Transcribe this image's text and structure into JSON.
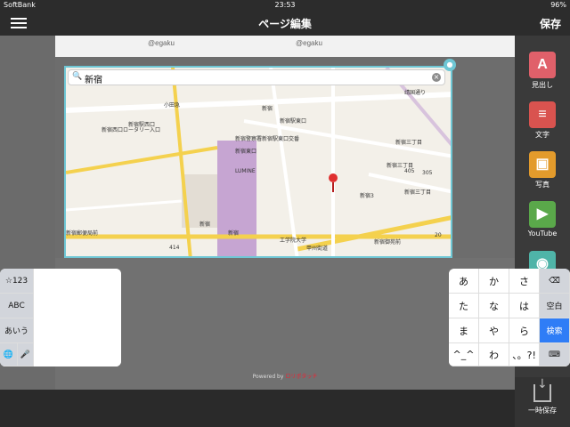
{
  "status": {
    "carrier": "SoftBank",
    "time": "23:53",
    "battery": "96%"
  },
  "nav": {
    "title": "ページ編集",
    "save": "保存"
  },
  "page": {
    "footer_prefix": "Powered by",
    "footer_brand": "ロリポタッチ",
    "art_texts": [
      "@egaku",
      "@egaku"
    ]
  },
  "map": {
    "search_value": "新宿",
    "labels": [
      "新宿西口ロータリー入口",
      "新宿駅西口",
      "新宿駅東口",
      "新宿警察署新宿駅東口交番",
      "新宿三丁目",
      "新宿三丁目",
      "新宿三丁目",
      "新宿3",
      "新宿御苑前",
      "新宿郵便局前",
      "新宿",
      "小田急",
      "甲州街道",
      "新宿",
      "新宿東口",
      "LUMINE",
      "405",
      "20",
      "414",
      "305",
      "靖国通り",
      "新宿",
      "工学院大学"
    ]
  },
  "sidebar": {
    "tools": [
      {
        "label": "見出し",
        "icon": "A",
        "color": "#e0606a"
      },
      {
        "label": "文字",
        "icon": "≡",
        "color": "#d9534f"
      },
      {
        "label": "写真",
        "icon": "▣",
        "color": "#e39b2c"
      },
      {
        "label": "YouTube",
        "icon": "▶",
        "color": "#5aa84a"
      },
      {
        "label": "",
        "icon": "◉",
        "color": "#4fb4a8"
      }
    ],
    "temp_save": "一時保存"
  },
  "keyboard": {
    "left_keys": [
      "☆123",
      "ABC",
      "あいう"
    ],
    "right_keys": [
      [
        "あ",
        "か",
        "さ"
      ],
      [
        "た",
        "な",
        "は"
      ],
      [
        "ま",
        "や",
        "ら"
      ],
      [
        "^_^",
        "わ",
        "、。?!"
      ]
    ],
    "space": "空白",
    "search": "検索"
  }
}
